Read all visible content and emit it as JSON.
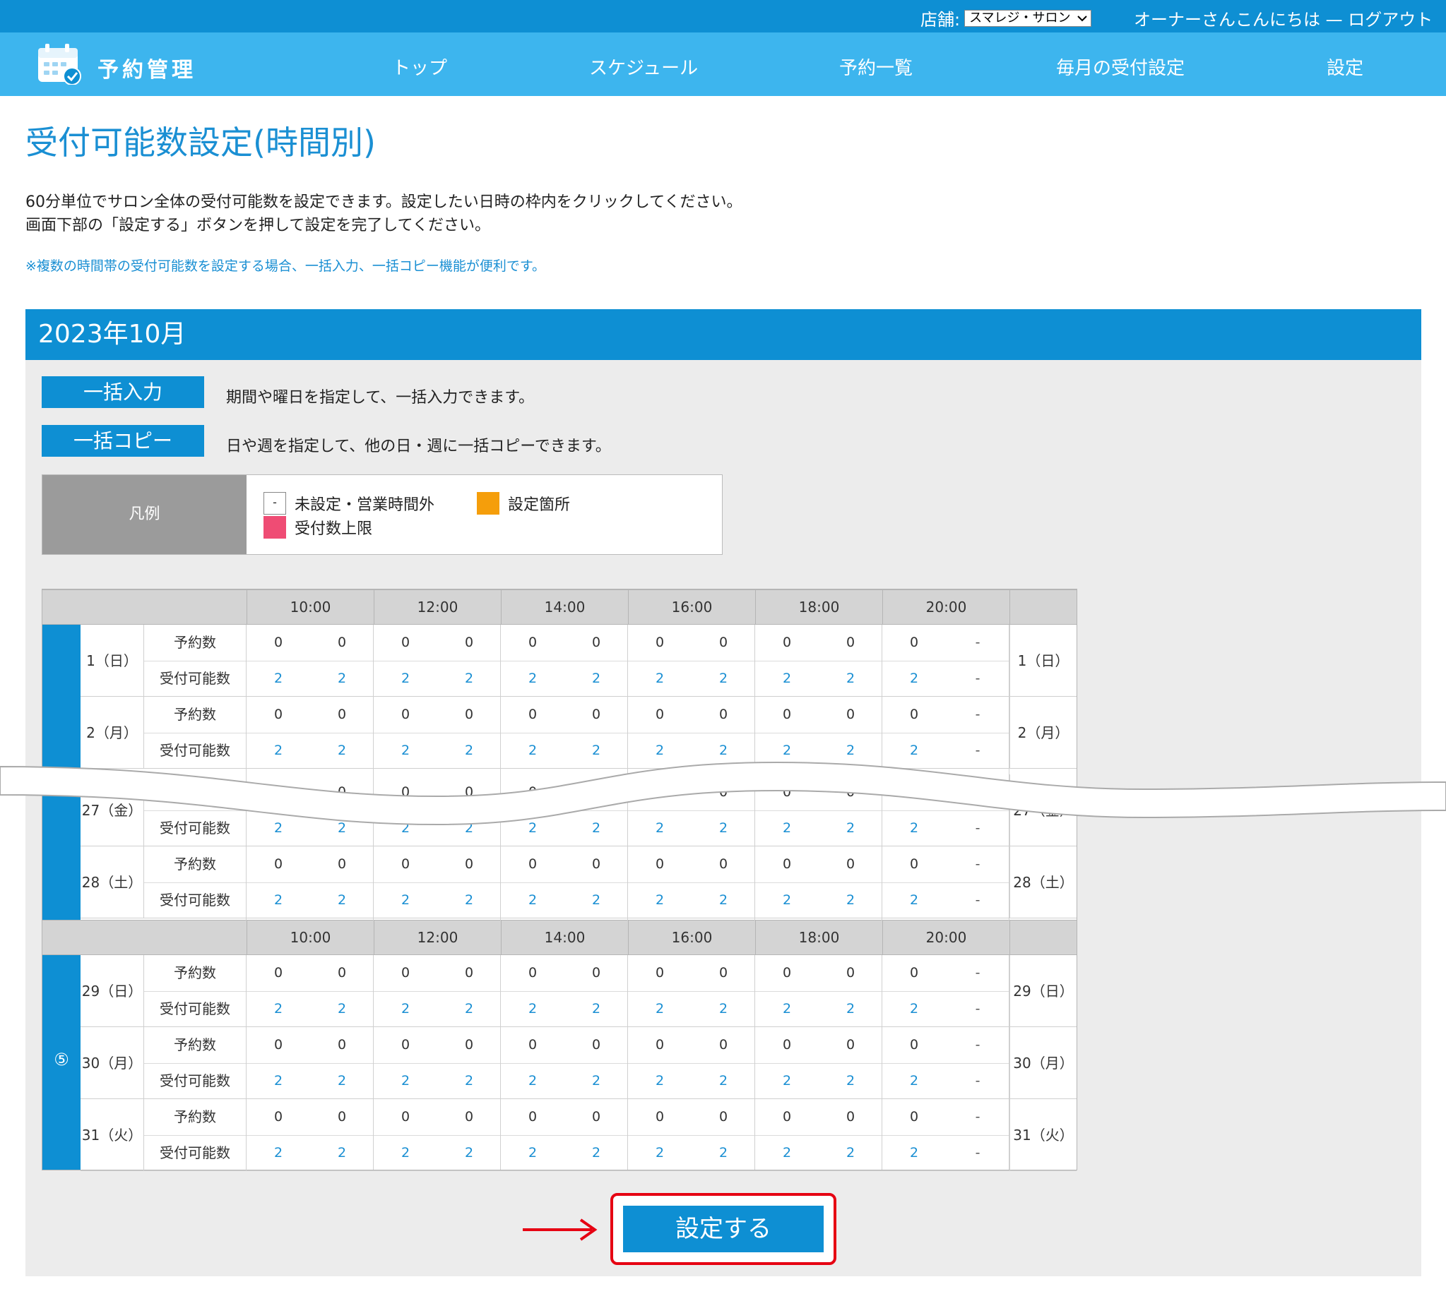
{
  "header": {
    "store_label": "店舗:",
    "store_value": "スマレジ・サロン",
    "greeting": "オーナーさんこんにちは",
    "separator": "—",
    "logout": "ログアウト"
  },
  "nav": {
    "app_name": "予約管理",
    "items": [
      "トップ",
      "スケジュール",
      "予約一覧",
      "毎月の受付設定",
      "設定"
    ]
  },
  "page": {
    "title": "受付可能数設定(時間別)",
    "desc_line1": "60分単位でサロン全体の受付可能数を設定できます。設定したい日時の枠内をクリックしてください。",
    "desc_line2": "画面下部の「設定する」ボタンを押して設定を完了してください。",
    "note": "※複数の時間帯の受付可能数を設定する場合、一括入力、一括コピー機能が便利です。",
    "month": "2023年10月"
  },
  "bulk": {
    "input_label": "一括入力",
    "input_desc": "期間や曜日を指定して、一括入力できます。",
    "copy_label": "一括コピー",
    "copy_desc": "日や週を指定して、他の日・週に一括コピーできます。"
  },
  "legend": {
    "label": "凡例",
    "blank_mark": "-",
    "blank_text": "未設定・営業時間外",
    "set_text": "設定箇所",
    "limit_text": "受付数上限",
    "colors": {
      "set": "#f59e0b",
      "limit": "#ef4c74"
    }
  },
  "table": {
    "times": [
      "10:00",
      "12:00",
      "14:00",
      "16:00",
      "18:00",
      "20:00"
    ],
    "row_labels": {
      "reserved": "予約数",
      "capacity": "受付可能数"
    },
    "reserved_values": [
      "0",
      "0",
      "0",
      "0",
      "0",
      "0",
      "0",
      "0",
      "0",
      "0",
      "0",
      "-"
    ],
    "capacity_values": [
      "2",
      "2",
      "2",
      "2",
      "2",
      "2",
      "2",
      "2",
      "2",
      "2",
      "2",
      "-"
    ],
    "week_mark": "⑤",
    "days": [
      "1（日）",
      "2（月）",
      "27（金）",
      "28（土）",
      "29（日）",
      "30（月）",
      "31（火）"
    ]
  },
  "submit": {
    "label": "設定する"
  },
  "colors": {
    "primary": "#0e8fd3",
    "nav": "#3db5ee",
    "highlight": "#e60012"
  }
}
